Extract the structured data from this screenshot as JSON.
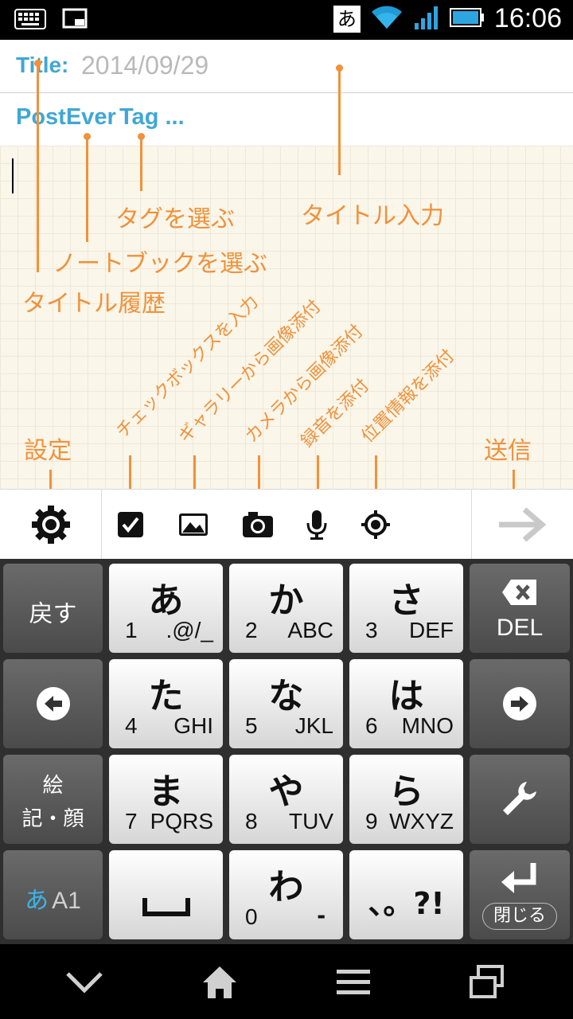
{
  "status_bar": {
    "ime_char": "あ",
    "time": "16:06"
  },
  "title_row": {
    "label": "Title:",
    "value": "2014/09/29"
  },
  "tag_row": {
    "notebook": "PostEver",
    "tag": "Tag ..."
  },
  "annotations": {
    "select_tag": "タグを選ぶ",
    "title_input": "タイトル入力",
    "select_notebook": "ノートブックを選ぶ",
    "title_history": "タイトル履歴",
    "checkbox_input": "チェックボックスを入力",
    "gallery_attach": "ギャラリーから画像添付",
    "camera_attach": "カメラから画像添付",
    "audio_attach": "録音を添付",
    "location_attach": "位置情報を添付",
    "settings": "設定",
    "send": "送信"
  },
  "toolbar": {
    "icons": [
      "gear-icon",
      "checkbox-icon",
      "image-icon",
      "camera-icon",
      "microphone-icon",
      "location-icon",
      "arrow-right-icon"
    ]
  },
  "keyboard": {
    "back": "戻す",
    "del": "DEL",
    "emoji_line1": "絵",
    "emoji_line2": "記・顔",
    "mode_a": "あ",
    "mode_b": "A1",
    "close": "閉じる",
    "keys": [
      {
        "main": "あ",
        "num": "1",
        "alpha": ".@/_"
      },
      {
        "main": "か",
        "num": "2",
        "alpha": "ABC"
      },
      {
        "main": "さ",
        "num": "3",
        "alpha": "DEF"
      },
      {
        "main": "た",
        "num": "4",
        "alpha": "GHI"
      },
      {
        "main": "な",
        "num": "5",
        "alpha": "JKL"
      },
      {
        "main": "は",
        "num": "6",
        "alpha": "MNO"
      },
      {
        "main": "ま",
        "num": "7",
        "alpha": "PQRS"
      },
      {
        "main": "や",
        "num": "8",
        "alpha": "TUV"
      },
      {
        "main": "ら",
        "num": "9",
        "alpha": "WXYZ"
      },
      {
        "main": "わ",
        "num": "0",
        "alpha": "-"
      }
    ],
    "punct": "、。?!"
  },
  "colors": {
    "accent_blue": "#3fa7d6",
    "annotation_orange": "#f1913a",
    "mode_blue": "#3ab4e8"
  }
}
